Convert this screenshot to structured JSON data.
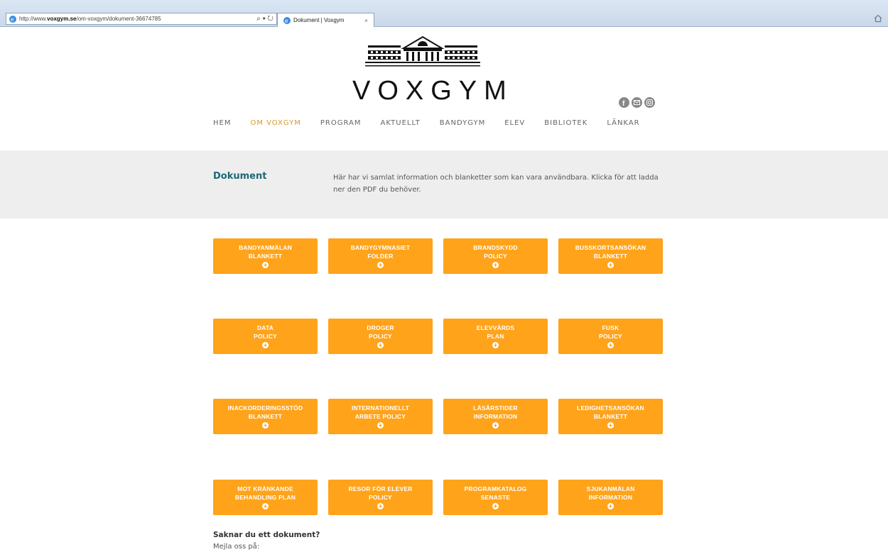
{
  "browser": {
    "url_prefix": "http://www.",
    "url_domain": "voxgym.se",
    "url_path": "/om-voxgym/dokument-36674785",
    "search_glyph": "⌕ ▾ ↻",
    "tab_title": "Dokument | Voxgym",
    "tab_close": "×"
  },
  "header": {
    "logo_text": "VOXGYM",
    "social_icons": [
      "facebook-icon",
      "mail-icon",
      "instagram-icon"
    ]
  },
  "nav": {
    "items": [
      "HEM",
      "OM VOXGYM",
      "PROGRAM",
      "AKTUELLT",
      "BANDYGYM",
      "ELEV",
      "BIBLIOTEK",
      "LÄNKAR"
    ],
    "active": "OM VOXGYM",
    "active_color": "#d99a2b"
  },
  "intro": {
    "title": "Dokument",
    "text": "Här har vi samlat information och blanketter som kan vara användbara. Klicka för att ladda ner den PDF du behöver."
  },
  "documents": [
    {
      "line1": "BANDYANMÄLAN",
      "line2": "BLANKETT"
    },
    {
      "line1": "BANDYGYMNASIET",
      "line2": "FOLDER"
    },
    {
      "line1": "BRANDSKYDD",
      "line2": "POLICY"
    },
    {
      "line1": "BUSSKORTSANSÖKAN",
      "line2": "BLANKETT"
    },
    {
      "line1": "DATA",
      "line2": "POLICY"
    },
    {
      "line1": "DROGER",
      "line2": "POLICY"
    },
    {
      "line1": "ELEVVÅRDS",
      "line2": "PLAN"
    },
    {
      "line1": "FUSK",
      "line2": "POLICY"
    },
    {
      "line1": "INACKORDERINGSSTÖD",
      "line2": "BLANKETT"
    },
    {
      "line1": "INTERNATIONELLT",
      "line2": "ARBETE POLICY"
    },
    {
      "line1": "LÄSÅRSTIDER",
      "line2": "INFORMATION"
    },
    {
      "line1": "LEDIGHETSANSÖKAN",
      "line2": "BLANKETT"
    },
    {
      "line1": "MOT KRÄNKANDE",
      "line2": "BEHANDLING PLAN"
    },
    {
      "line1": "RESOR FÖR ELEVER",
      "line2": "POLICY"
    },
    {
      "line1": "PROGRAMKATALOG",
      "line2": "SENASTE"
    },
    {
      "line1": "SJUKANMÄLAN",
      "line2": "INFORMATION"
    }
  ],
  "button_color": "#ffa31a",
  "missing": {
    "title": "Saknar du ett dokument?",
    "text": "Mejla oss på:"
  }
}
